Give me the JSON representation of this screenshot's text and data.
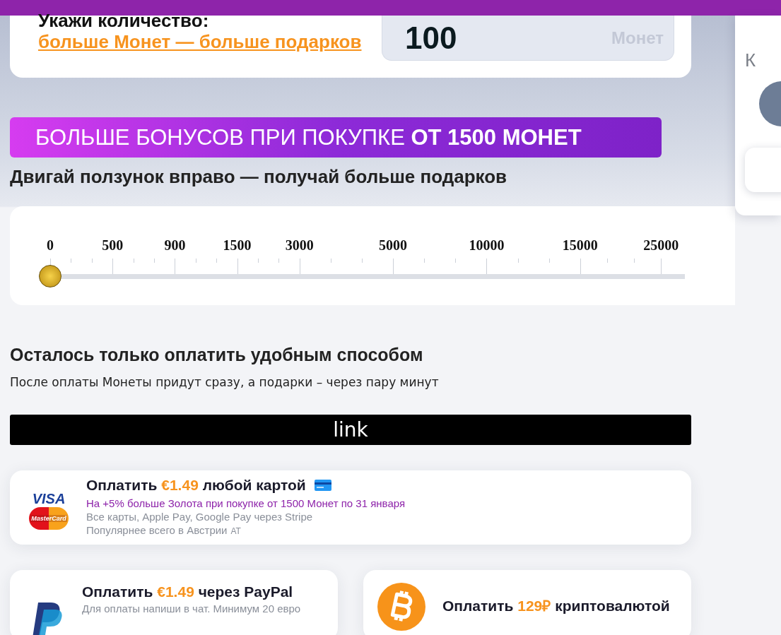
{
  "quantity": {
    "label": "Укажи количество:",
    "link": "больше Монет — больше подарков",
    "value": "100",
    "unit": "Монет"
  },
  "bonus_banner": "БОЛЬШЕ БОНУСОВ ПРИ ПОКУПКЕ **ОТ 1500 МОНЕТ**",
  "slider_heading": "Двигай ползунок вправо — получай больше подарков",
  "slider": {
    "level": 0,
    "ticks": [
      "0",
      "500",
      "900",
      "1500",
      "3000",
      "5000",
      "10000",
      "15000",
      "25000"
    ]
  },
  "payment": {
    "heading": "Осталось только оплатить удобным способом",
    "subtitle": "После оплаты Монеты придут сразу, а подарки – через пару минут",
    "link_button": "link"
  },
  "methods": [
    {
      "kind": "card",
      "logo_text": [
        "VISA",
        "MasterCard"
      ],
      "prefix": "Оплатить ",
      "price": "€1.49",
      "suffix": " любой картой",
      "promo": "На +5% больше Золота при покупке от 1500 Монет по 31 января",
      "notes": [
        "Все карты, Apple Pay, Google Pay через Stripe",
        "Популярнее всего в Австрии"
      ],
      "country": "AT"
    },
    {
      "kind": "paypal",
      "prefix": "Оплатить ",
      "price": "€1.49",
      "suffix": " через PayPal",
      "notes": [
        "Для оплаты напиши в чат. Минимум 20 евро"
      ]
    },
    {
      "kind": "crypto",
      "prefix": "Оплатить ",
      "price": "129₽",
      "suffix": " криптовалютой"
    }
  ],
  "side_panel": {
    "title": "К"
  }
}
